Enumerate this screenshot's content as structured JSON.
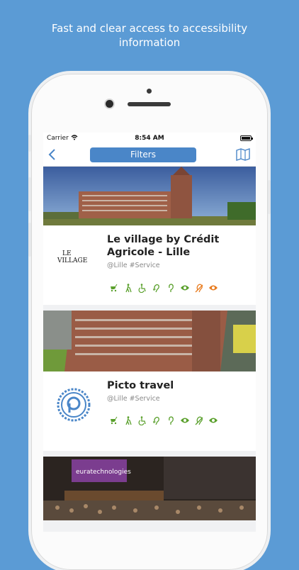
{
  "tagline": {
    "line1": "Fast and clear access to accessibility",
    "line2": "information"
  },
  "status": {
    "carrier": "Carrier",
    "time": "8:54 AM"
  },
  "nav": {
    "filters_label": "Filters"
  },
  "places": [
    {
      "title_line1": "Le village by Crédit",
      "title_line2": "Agricole - Lille",
      "tags": "@Lille #Service",
      "logo_text": "VILLAGE",
      "logo_prefix": "LE",
      "icons": [
        "stroller-icon",
        "walking-icon",
        "wheelchair-icon",
        "ear-icon",
        "hearing-aid-icon",
        "eye-icon",
        "hearing-impaired-icon",
        "eye-orange-icon"
      ]
    },
    {
      "title_line1": "Picto travel",
      "tags": "@Lille #Service",
      "icons": [
        "stroller-icon",
        "walking-icon",
        "wheelchair-icon",
        "ear-icon",
        "hearing-aid-icon",
        "eye-icon",
        "hearing-impaired-icon",
        "eye-icon"
      ]
    }
  ],
  "third_card": {
    "banner_text": "euratechnologies"
  },
  "colors": {
    "background": "#5b9bd5",
    "accent": "#4a86c8",
    "green": "#5aa02c",
    "orange": "#e87b1e"
  }
}
